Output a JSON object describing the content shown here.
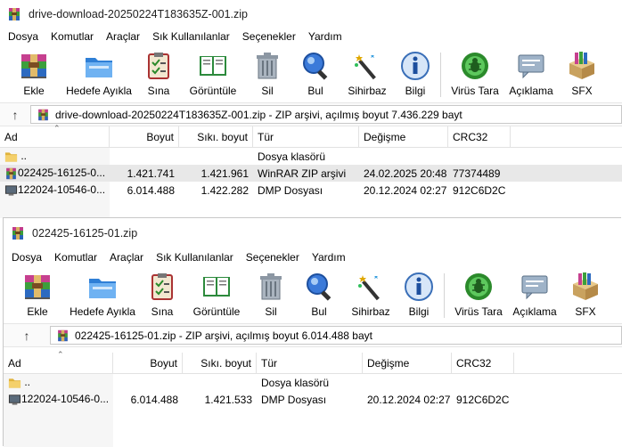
{
  "w1": {
    "title": "drive-download-20250224T183635Z-001.zip",
    "menu": [
      "Dosya",
      "Komutlar",
      "Araçlar",
      "Sık Kullanılanlar",
      "Seçenekler",
      "Yardım"
    ],
    "toolbar": [
      "Ekle",
      "Hedefe Ayıkla",
      "Sına",
      "Görüntüle",
      "Sil",
      "Bul",
      "Sihirbaz",
      "Bilgi",
      "Virüs Tara",
      "Açıklama",
      "SFX"
    ],
    "address": "drive-download-20250224T183635Z-001.zip - ZIP arşivi, açılmış boyut 7.436.229 bayt",
    "columns": [
      "Ad",
      "Boyut",
      "Sıkı. boyut",
      "Tür",
      "Değişme",
      "CRC32"
    ],
    "rows": [
      {
        "name": "..",
        "size": "",
        "packed": "",
        "type": "Dosya klasörü",
        "modified": "",
        "crc": ""
      },
      {
        "name": "022425-16125-0...",
        "size": "1.421.741",
        "packed": "1.421.961",
        "type": "WinRAR ZIP arşivi",
        "modified": "24.02.2025 20:48",
        "crc": "77374489"
      },
      {
        "name": "122024-10546-0...",
        "size": "6.014.488",
        "packed": "1.422.282",
        "type": "DMP Dosyası",
        "modified": "20.12.2024 02:27",
        "crc": "912C6D2C"
      }
    ]
  },
  "w2": {
    "title": "022425-16125-01.zip",
    "menu": [
      "Dosya",
      "Komutlar",
      "Araçlar",
      "Sık Kullanılanlar",
      "Seçenekler",
      "Yardım"
    ],
    "toolbar": [
      "Ekle",
      "Hedefe Ayıkla",
      "Sına",
      "Görüntüle",
      "Sil",
      "Bul",
      "Sihirbaz",
      "Bilgi",
      "Virüs Tara",
      "Açıklama",
      "SFX"
    ],
    "address": "022425-16125-01.zip - ZIP arşivi, açılmış boyut 6.014.488 bayt",
    "columns": [
      "Ad",
      "Boyut",
      "Sıkı. boyut",
      "Tür",
      "Değişme",
      "CRC32"
    ],
    "rows": [
      {
        "name": "..",
        "size": "",
        "packed": "",
        "type": "Dosya klasörü",
        "modified": "",
        "crc": ""
      },
      {
        "name": "122024-10546-0...",
        "size": "6.014.488",
        "packed": "1.421.533",
        "type": "DMP Dosyası",
        "modified": "20.12.2024 02:27",
        "crc": "912C6D2C"
      }
    ]
  },
  "icons": [
    "winrar-icon",
    "add-icon",
    "extract-icon",
    "test-icon",
    "view-icon",
    "delete-icon",
    "find-icon",
    "wizard-icon",
    "info-icon",
    "virus-scan-icon",
    "comment-icon",
    "sfx-icon",
    "up-arrow-icon",
    "folder-icon",
    "dmp-file-icon"
  ],
  "colors": {
    "selected_row": "#e8e8e8",
    "sidebar": "#f6f6f6"
  }
}
